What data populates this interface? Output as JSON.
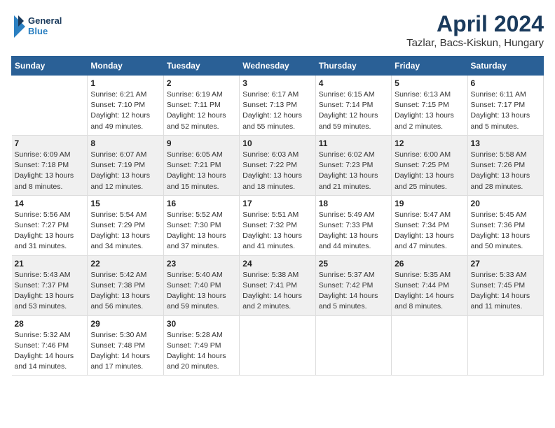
{
  "header": {
    "logo_line1": "General",
    "logo_line2": "Blue",
    "month": "April 2024",
    "location": "Tazlar, Bacs-Kiskun, Hungary"
  },
  "days_header": [
    "Sunday",
    "Monday",
    "Tuesday",
    "Wednesday",
    "Thursday",
    "Friday",
    "Saturday"
  ],
  "weeks": [
    [
      {
        "num": "",
        "info": ""
      },
      {
        "num": "1",
        "info": "Sunrise: 6:21 AM\nSunset: 7:10 PM\nDaylight: 12 hours\nand 49 minutes."
      },
      {
        "num": "2",
        "info": "Sunrise: 6:19 AM\nSunset: 7:11 PM\nDaylight: 12 hours\nand 52 minutes."
      },
      {
        "num": "3",
        "info": "Sunrise: 6:17 AM\nSunset: 7:13 PM\nDaylight: 12 hours\nand 55 minutes."
      },
      {
        "num": "4",
        "info": "Sunrise: 6:15 AM\nSunset: 7:14 PM\nDaylight: 12 hours\nand 59 minutes."
      },
      {
        "num": "5",
        "info": "Sunrise: 6:13 AM\nSunset: 7:15 PM\nDaylight: 13 hours\nand 2 minutes."
      },
      {
        "num": "6",
        "info": "Sunrise: 6:11 AM\nSunset: 7:17 PM\nDaylight: 13 hours\nand 5 minutes."
      }
    ],
    [
      {
        "num": "7",
        "info": "Sunrise: 6:09 AM\nSunset: 7:18 PM\nDaylight: 13 hours\nand 8 minutes."
      },
      {
        "num": "8",
        "info": "Sunrise: 6:07 AM\nSunset: 7:19 PM\nDaylight: 13 hours\nand 12 minutes."
      },
      {
        "num": "9",
        "info": "Sunrise: 6:05 AM\nSunset: 7:21 PM\nDaylight: 13 hours\nand 15 minutes."
      },
      {
        "num": "10",
        "info": "Sunrise: 6:03 AM\nSunset: 7:22 PM\nDaylight: 13 hours\nand 18 minutes."
      },
      {
        "num": "11",
        "info": "Sunrise: 6:02 AM\nSunset: 7:23 PM\nDaylight: 13 hours\nand 21 minutes."
      },
      {
        "num": "12",
        "info": "Sunrise: 6:00 AM\nSunset: 7:25 PM\nDaylight: 13 hours\nand 25 minutes."
      },
      {
        "num": "13",
        "info": "Sunrise: 5:58 AM\nSunset: 7:26 PM\nDaylight: 13 hours\nand 28 minutes."
      }
    ],
    [
      {
        "num": "14",
        "info": "Sunrise: 5:56 AM\nSunset: 7:27 PM\nDaylight: 13 hours\nand 31 minutes."
      },
      {
        "num": "15",
        "info": "Sunrise: 5:54 AM\nSunset: 7:29 PM\nDaylight: 13 hours\nand 34 minutes."
      },
      {
        "num": "16",
        "info": "Sunrise: 5:52 AM\nSunset: 7:30 PM\nDaylight: 13 hours\nand 37 minutes."
      },
      {
        "num": "17",
        "info": "Sunrise: 5:51 AM\nSunset: 7:32 PM\nDaylight: 13 hours\nand 41 minutes."
      },
      {
        "num": "18",
        "info": "Sunrise: 5:49 AM\nSunset: 7:33 PM\nDaylight: 13 hours\nand 44 minutes."
      },
      {
        "num": "19",
        "info": "Sunrise: 5:47 AM\nSunset: 7:34 PM\nDaylight: 13 hours\nand 47 minutes."
      },
      {
        "num": "20",
        "info": "Sunrise: 5:45 AM\nSunset: 7:36 PM\nDaylight: 13 hours\nand 50 minutes."
      }
    ],
    [
      {
        "num": "21",
        "info": "Sunrise: 5:43 AM\nSunset: 7:37 PM\nDaylight: 13 hours\nand 53 minutes."
      },
      {
        "num": "22",
        "info": "Sunrise: 5:42 AM\nSunset: 7:38 PM\nDaylight: 13 hours\nand 56 minutes."
      },
      {
        "num": "23",
        "info": "Sunrise: 5:40 AM\nSunset: 7:40 PM\nDaylight: 13 hours\nand 59 minutes."
      },
      {
        "num": "24",
        "info": "Sunrise: 5:38 AM\nSunset: 7:41 PM\nDaylight: 14 hours\nand 2 minutes."
      },
      {
        "num": "25",
        "info": "Sunrise: 5:37 AM\nSunset: 7:42 PM\nDaylight: 14 hours\nand 5 minutes."
      },
      {
        "num": "26",
        "info": "Sunrise: 5:35 AM\nSunset: 7:44 PM\nDaylight: 14 hours\nand 8 minutes."
      },
      {
        "num": "27",
        "info": "Sunrise: 5:33 AM\nSunset: 7:45 PM\nDaylight: 14 hours\nand 11 minutes."
      }
    ],
    [
      {
        "num": "28",
        "info": "Sunrise: 5:32 AM\nSunset: 7:46 PM\nDaylight: 14 hours\nand 14 minutes."
      },
      {
        "num": "29",
        "info": "Sunrise: 5:30 AM\nSunset: 7:48 PM\nDaylight: 14 hours\nand 17 minutes."
      },
      {
        "num": "30",
        "info": "Sunrise: 5:28 AM\nSunset: 7:49 PM\nDaylight: 14 hours\nand 20 minutes."
      },
      {
        "num": "",
        "info": ""
      },
      {
        "num": "",
        "info": ""
      },
      {
        "num": "",
        "info": ""
      },
      {
        "num": "",
        "info": ""
      }
    ]
  ]
}
